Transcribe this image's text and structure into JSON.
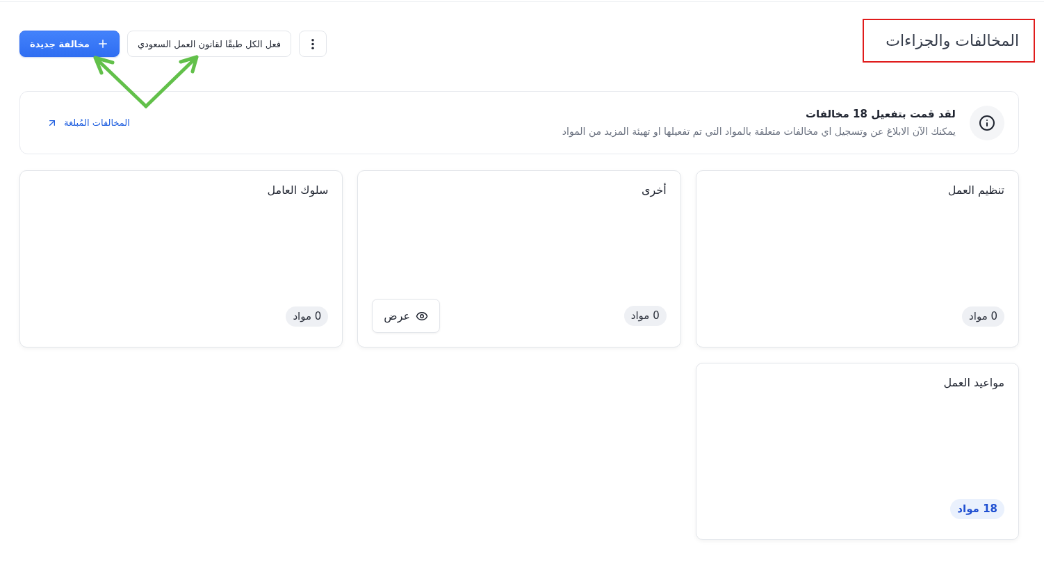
{
  "header": {
    "title": "المخالفات والجزاءات",
    "framed": true,
    "actions": [
      {
        "kind": "menu"
      },
      {
        "kind": "secondary",
        "label": "فعل الكل طبقًا لقانون العمل السعودي"
      },
      {
        "kind": "primary",
        "label": "مخالفة جديدة"
      }
    ]
  },
  "annotation_arrows": true,
  "banner": {
    "title": "لقد قمت بتفعيل 18 مخالفات",
    "text": "يمكنك الآن الابلاغ عن وتسجيل اي مخالفات متعلقة بالمواد التي تم تفعيلها او تهيئة المزيد من المواد",
    "link": "المخالفات المُبلغة"
  },
  "cards": [
    {
      "title": "تنظيم العمل",
      "count": "0 مواد",
      "highlighted": false
    },
    {
      "title": "أخرى",
      "count": "0 مواد",
      "highlighted": false,
      "view_button": "عرض"
    },
    {
      "title": "سلوك العامل",
      "count": "0 مواد",
      "highlighted": false
    },
    {
      "title": "مواعيد العمل",
      "count": "18 مواد",
      "highlighted": true
    }
  ]
}
